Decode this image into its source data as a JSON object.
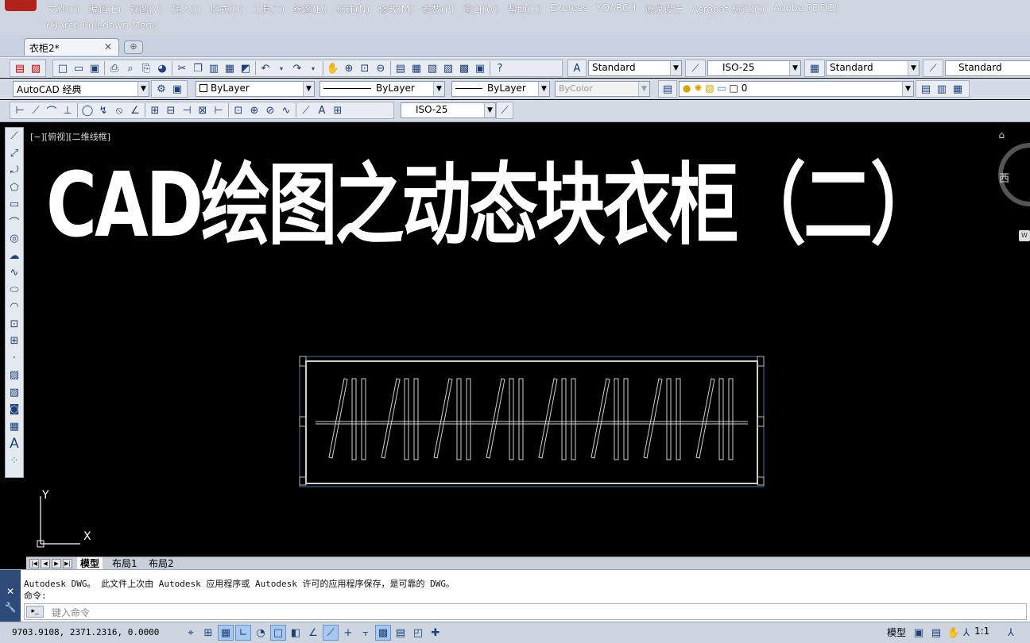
{
  "menubar": {
    "items": [
      "文件(F)",
      "编辑(E)",
      "视图(V)",
      "插入(I)",
      "格式(O)",
      "工具(T)",
      "绘图(D)",
      "标注(N)",
      "修改(M)",
      "参数(P)",
      "窗口(W)",
      "帮助(H)",
      "Express",
      "YQARCH",
      "源泉设计",
      "Acrobat 标记(C)",
      "Adobe PDF(B)"
    ],
    "row2": "YQArch Pull-down Menu"
  },
  "tabs": {
    "doc_tab": "衣柜2*",
    "close_glyph": "✕"
  },
  "toolbar1": {
    "text_style": "Standard",
    "dim_style": "ISO-25",
    "table_style": "Standard",
    "mleader_style": "Standard"
  },
  "toolbar2": {
    "workspace": "AutoCAD 经典",
    "color": "ByLayer",
    "linetype": "ByLayer",
    "lineweight": "ByLayer",
    "plotstyle": "ByColor",
    "layer": "0"
  },
  "toolbar3": {
    "dim_style": "ISO-25"
  },
  "canvas": {
    "viewport_label": "[−][俯视][二维线框]",
    "overlay_title": "CAD绘图之动态块衣柜（二）",
    "viewcube_label": "西",
    "wcs_badge": "W",
    "ucs_x": "X",
    "ucs_y": "Y"
  },
  "layout_tabs": [
    "模型",
    "布局1",
    "布局2"
  ],
  "command": {
    "history_line1": "Autodesk DWG。  此文件上次由 Autodesk 应用程序或 Autodesk 许可的应用程序保存，是可靠的 DWG。",
    "history_line2": "命令:",
    "placeholder": "键入命令"
  },
  "statusbar": {
    "coords": "9703.9108, 2371.2316, 0.0000",
    "model_label": "模型",
    "scale": "1:1"
  },
  "colors": {
    "menubar_bg": "#cfd6e2",
    "canvas_bg": "#000000",
    "drawing_stroke": "#d0d0d0",
    "drawing_frame": "#4a6fa5"
  }
}
